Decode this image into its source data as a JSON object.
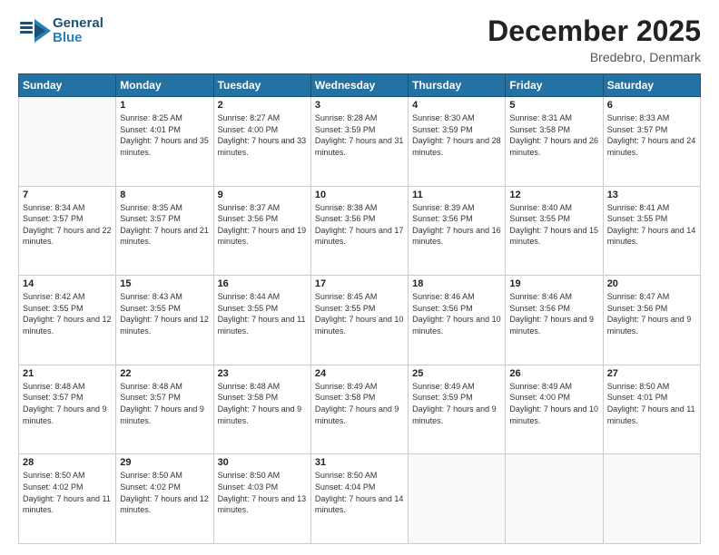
{
  "logo": {
    "line1": "General",
    "line2": "Blue"
  },
  "header": {
    "month": "December 2025",
    "location": "Bredebro, Denmark"
  },
  "weekdays": [
    "Sunday",
    "Monday",
    "Tuesday",
    "Wednesday",
    "Thursday",
    "Friday",
    "Saturday"
  ],
  "weeks": [
    [
      {
        "day": "",
        "sunrise": "",
        "sunset": "",
        "daylight": ""
      },
      {
        "day": "1",
        "sunrise": "Sunrise: 8:25 AM",
        "sunset": "Sunset: 4:01 PM",
        "daylight": "Daylight: 7 hours and 35 minutes."
      },
      {
        "day": "2",
        "sunrise": "Sunrise: 8:27 AM",
        "sunset": "Sunset: 4:00 PM",
        "daylight": "Daylight: 7 hours and 33 minutes."
      },
      {
        "day": "3",
        "sunrise": "Sunrise: 8:28 AM",
        "sunset": "Sunset: 3:59 PM",
        "daylight": "Daylight: 7 hours and 31 minutes."
      },
      {
        "day": "4",
        "sunrise": "Sunrise: 8:30 AM",
        "sunset": "Sunset: 3:59 PM",
        "daylight": "Daylight: 7 hours and 28 minutes."
      },
      {
        "day": "5",
        "sunrise": "Sunrise: 8:31 AM",
        "sunset": "Sunset: 3:58 PM",
        "daylight": "Daylight: 7 hours and 26 minutes."
      },
      {
        "day": "6",
        "sunrise": "Sunrise: 8:33 AM",
        "sunset": "Sunset: 3:57 PM",
        "daylight": "Daylight: 7 hours and 24 minutes."
      }
    ],
    [
      {
        "day": "7",
        "sunrise": "Sunrise: 8:34 AM",
        "sunset": "Sunset: 3:57 PM",
        "daylight": "Daylight: 7 hours and 22 minutes."
      },
      {
        "day": "8",
        "sunrise": "Sunrise: 8:35 AM",
        "sunset": "Sunset: 3:57 PM",
        "daylight": "Daylight: 7 hours and 21 minutes."
      },
      {
        "day": "9",
        "sunrise": "Sunrise: 8:37 AM",
        "sunset": "Sunset: 3:56 PM",
        "daylight": "Daylight: 7 hours and 19 minutes."
      },
      {
        "day": "10",
        "sunrise": "Sunrise: 8:38 AM",
        "sunset": "Sunset: 3:56 PM",
        "daylight": "Daylight: 7 hours and 17 minutes."
      },
      {
        "day": "11",
        "sunrise": "Sunrise: 8:39 AM",
        "sunset": "Sunset: 3:56 PM",
        "daylight": "Daylight: 7 hours and 16 minutes."
      },
      {
        "day": "12",
        "sunrise": "Sunrise: 8:40 AM",
        "sunset": "Sunset: 3:55 PM",
        "daylight": "Daylight: 7 hours and 15 minutes."
      },
      {
        "day": "13",
        "sunrise": "Sunrise: 8:41 AM",
        "sunset": "Sunset: 3:55 PM",
        "daylight": "Daylight: 7 hours and 14 minutes."
      }
    ],
    [
      {
        "day": "14",
        "sunrise": "Sunrise: 8:42 AM",
        "sunset": "Sunset: 3:55 PM",
        "daylight": "Daylight: 7 hours and 12 minutes."
      },
      {
        "day": "15",
        "sunrise": "Sunrise: 8:43 AM",
        "sunset": "Sunset: 3:55 PM",
        "daylight": "Daylight: 7 hours and 12 minutes."
      },
      {
        "day": "16",
        "sunrise": "Sunrise: 8:44 AM",
        "sunset": "Sunset: 3:55 PM",
        "daylight": "Daylight: 7 hours and 11 minutes."
      },
      {
        "day": "17",
        "sunrise": "Sunrise: 8:45 AM",
        "sunset": "Sunset: 3:55 PM",
        "daylight": "Daylight: 7 hours and 10 minutes."
      },
      {
        "day": "18",
        "sunrise": "Sunrise: 8:46 AM",
        "sunset": "Sunset: 3:56 PM",
        "daylight": "Daylight: 7 hours and 10 minutes."
      },
      {
        "day": "19",
        "sunrise": "Sunrise: 8:46 AM",
        "sunset": "Sunset: 3:56 PM",
        "daylight": "Daylight: 7 hours and 9 minutes."
      },
      {
        "day": "20",
        "sunrise": "Sunrise: 8:47 AM",
        "sunset": "Sunset: 3:56 PM",
        "daylight": "Daylight: 7 hours and 9 minutes."
      }
    ],
    [
      {
        "day": "21",
        "sunrise": "Sunrise: 8:48 AM",
        "sunset": "Sunset: 3:57 PM",
        "daylight": "Daylight: 7 hours and 9 minutes."
      },
      {
        "day": "22",
        "sunrise": "Sunrise: 8:48 AM",
        "sunset": "Sunset: 3:57 PM",
        "daylight": "Daylight: 7 hours and 9 minutes."
      },
      {
        "day": "23",
        "sunrise": "Sunrise: 8:48 AM",
        "sunset": "Sunset: 3:58 PM",
        "daylight": "Daylight: 7 hours and 9 minutes."
      },
      {
        "day": "24",
        "sunrise": "Sunrise: 8:49 AM",
        "sunset": "Sunset: 3:58 PM",
        "daylight": "Daylight: 7 hours and 9 minutes."
      },
      {
        "day": "25",
        "sunrise": "Sunrise: 8:49 AM",
        "sunset": "Sunset: 3:59 PM",
        "daylight": "Daylight: 7 hours and 9 minutes."
      },
      {
        "day": "26",
        "sunrise": "Sunrise: 8:49 AM",
        "sunset": "Sunset: 4:00 PM",
        "daylight": "Daylight: 7 hours and 10 minutes."
      },
      {
        "day": "27",
        "sunrise": "Sunrise: 8:50 AM",
        "sunset": "Sunset: 4:01 PM",
        "daylight": "Daylight: 7 hours and 11 minutes."
      }
    ],
    [
      {
        "day": "28",
        "sunrise": "Sunrise: 8:50 AM",
        "sunset": "Sunset: 4:02 PM",
        "daylight": "Daylight: 7 hours and 11 minutes."
      },
      {
        "day": "29",
        "sunrise": "Sunrise: 8:50 AM",
        "sunset": "Sunset: 4:02 PM",
        "daylight": "Daylight: 7 hours and 12 minutes."
      },
      {
        "day": "30",
        "sunrise": "Sunrise: 8:50 AM",
        "sunset": "Sunset: 4:03 PM",
        "daylight": "Daylight: 7 hours and 13 minutes."
      },
      {
        "day": "31",
        "sunrise": "Sunrise: 8:50 AM",
        "sunset": "Sunset: 4:04 PM",
        "daylight": "Daylight: 7 hours and 14 minutes."
      },
      {
        "day": "",
        "sunrise": "",
        "sunset": "",
        "daylight": ""
      },
      {
        "day": "",
        "sunrise": "",
        "sunset": "",
        "daylight": ""
      },
      {
        "day": "",
        "sunrise": "",
        "sunset": "",
        "daylight": ""
      }
    ]
  ]
}
